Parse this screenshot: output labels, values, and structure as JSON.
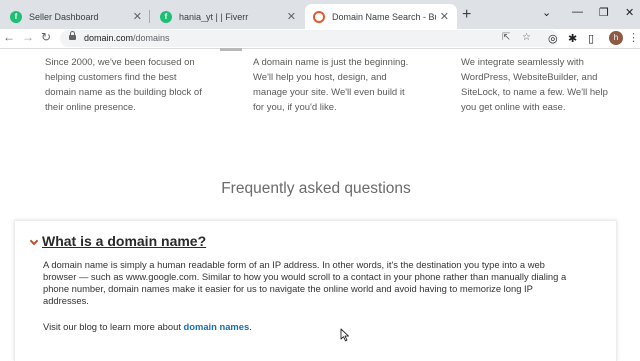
{
  "browser": {
    "tabs": [
      {
        "title": "Seller Dashboard",
        "favicon": "fiverr-icon",
        "active": false
      },
      {
        "title": "hania_yt | | Fiverr",
        "favicon": "fiverr-icon",
        "active": false
      },
      {
        "title": "Domain Name Search - Buy Dom",
        "favicon": "domain-com-icon",
        "active": true
      }
    ],
    "url_host": "domain.com",
    "url_path": "/domains",
    "profile_initial": "h",
    "colors": {
      "fiverr": "#1dbf73",
      "domain_com": "#e8572b"
    }
  },
  "features": [
    {
      "lines": [
        "Since 2000, we've been focused on",
        "helping customers find the best",
        "domain name as the building block of",
        "their online presence."
      ]
    },
    {
      "lines": [
        "A domain name is just the beginning.",
        "We'll help you host, design, and",
        "manage your site. We'll even build it",
        "for you, if you'd like."
      ]
    },
    {
      "lines": [
        "We integrate seamlessly with",
        "WordPress, WebsiteBuilder, and",
        "SiteLock, to name a few. We'll help",
        "you get online with ease."
      ]
    }
  ],
  "faq": {
    "heading": "Frequently asked questions",
    "question": "What is a domain name?",
    "answer_lines": [
      "A domain name is simply a human readable form of an IP address. In other words, it's the destination you type into a web",
      "browser — such as www.google.com. Similar to how you would scroll to a contact in your phone rather than manually dialing a",
      "phone number, domain names make it easier for us to navigate the online world and avoid having to memorize long IP",
      "addresses."
    ],
    "blog_prefix": "Visit our blog to learn more about ",
    "blog_link": "domain names",
    "blog_suffix": ".",
    "accent_color": "#c0502a",
    "link_color": "#1a6fb3"
  }
}
